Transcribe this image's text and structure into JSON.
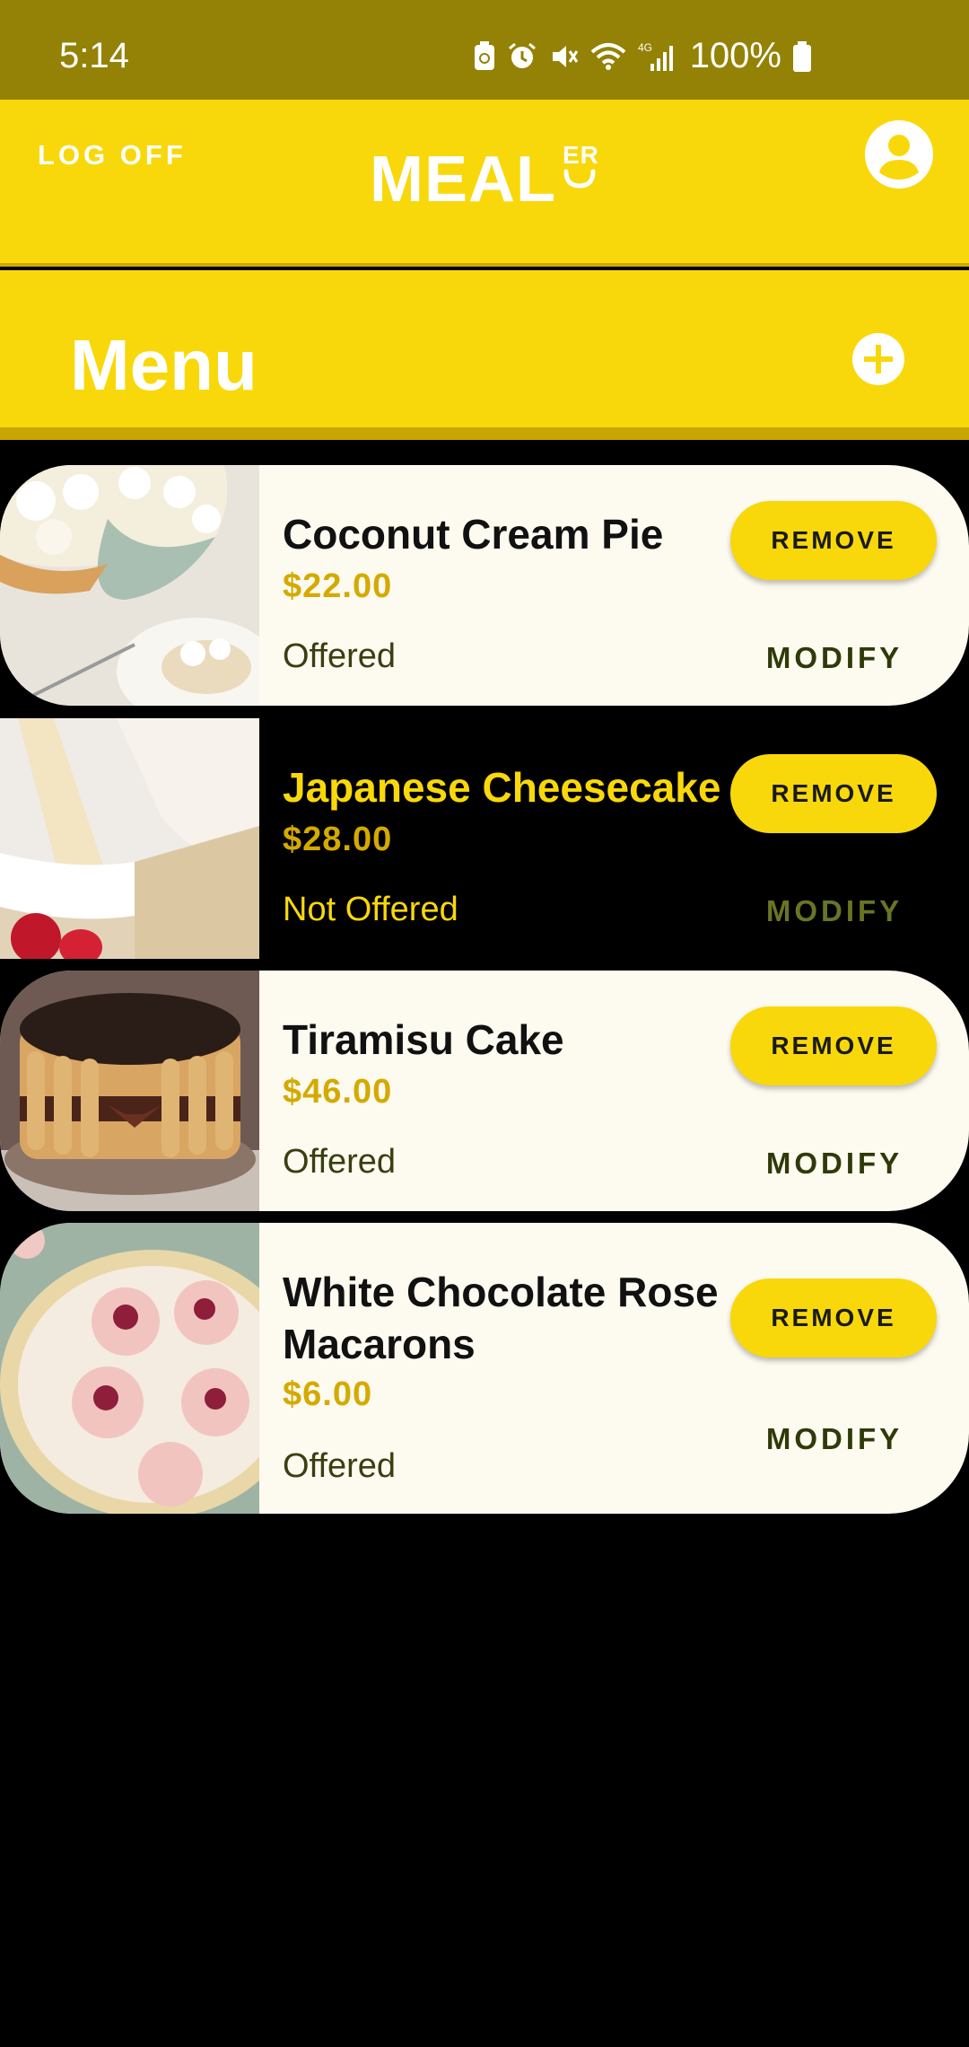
{
  "status_bar": {
    "time": "5:14",
    "network": "4G",
    "battery": "100%"
  },
  "header": {
    "logoff_label": "LOG OFF",
    "logo_text": "MEAL",
    "logo_suffix": "ER"
  },
  "menu": {
    "title": "Menu"
  },
  "items": [
    {
      "name": "Coconut Cream Pie",
      "price": "$22.00",
      "status": "Offered",
      "remove_label": "REMOVE",
      "modify_label": "MODIFY"
    },
    {
      "name": "Japanese Cheesecake",
      "price": "$28.00",
      "status": "Not Offered",
      "remove_label": "REMOVE",
      "modify_label": "MODIFY"
    },
    {
      "name": "Tiramisu Cake",
      "price": "$46.00",
      "status": "Offered",
      "remove_label": "REMOVE",
      "modify_label": "MODIFY"
    },
    {
      "name": "White Chocolate Rose Macarons",
      "price": "$6.00",
      "status": "Offered",
      "remove_label": "REMOVE",
      "modify_label": "MODIFY"
    }
  ],
  "colors": {
    "status_bar": "#948206",
    "brand_yellow": "#F8D80A",
    "price": "#D4AA00",
    "card_bg": "#FDFAF0"
  }
}
